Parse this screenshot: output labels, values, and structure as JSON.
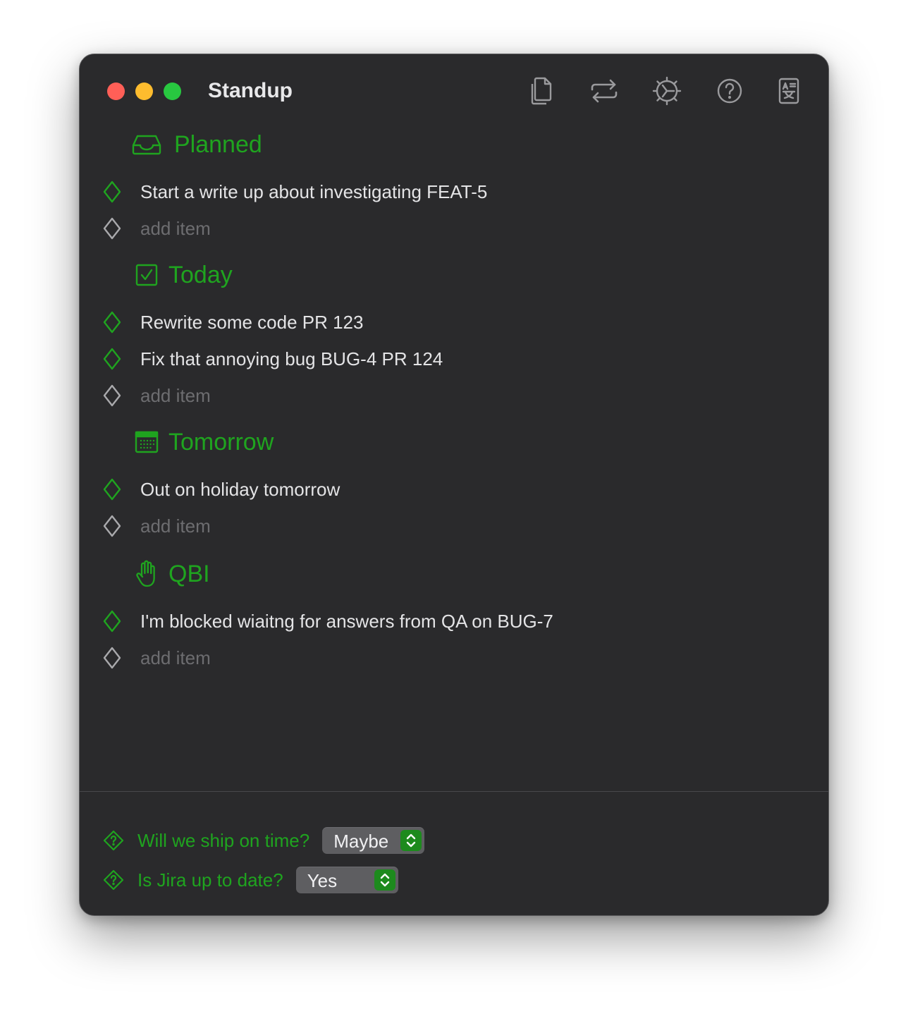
{
  "window": {
    "title": "Standup"
  },
  "toolbar": {
    "icons": [
      "copy-icon",
      "swap-icon",
      "settings-icon",
      "help-icon",
      "translate-icon"
    ]
  },
  "sections": [
    {
      "title": "Planned",
      "icon": "inbox-tray-icon",
      "items": [
        "Start a write up about investigating FEAT-5"
      ],
      "placeholder": "add item"
    },
    {
      "title": "Today",
      "icon": "checkmark-square-icon",
      "items": [
        "Rewrite some code PR 123",
        "Fix that annoying bug BUG-4 PR 124"
      ],
      "placeholder": "add item"
    },
    {
      "title": "Tomorrow",
      "icon": "calendar-icon",
      "items": [
        "Out on holiday tomorrow"
      ],
      "placeholder": "add item"
    },
    {
      "title": "QBI",
      "icon": "raised-hand-icon",
      "items": [
        "I'm blocked wiaitng for answers from QA on BUG-7"
      ],
      "placeholder": "add item"
    }
  ],
  "questions": [
    {
      "label": "Will we ship on time?",
      "value": "Maybe"
    },
    {
      "label": "Is Jira up to date?",
      "value": "Yes"
    }
  ],
  "colors": {
    "accent": "#1fa41f",
    "window_bg": "#2a2a2c",
    "text": "#e4e4e6",
    "placeholder": "#6d6d70"
  }
}
